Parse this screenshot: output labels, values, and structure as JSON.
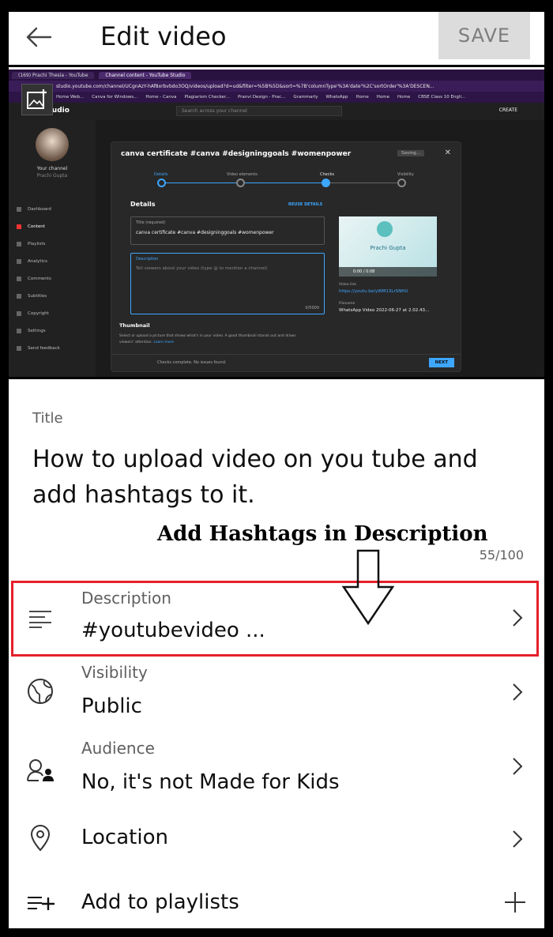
{
  "header": {
    "back_icon": "arrow-left-icon",
    "title": "Edit video",
    "save_label": "SAVE"
  },
  "screenshot": {
    "browser": {
      "tabs": [
        "(169) Prachi Thesia - YouTube",
        "Channel content - YouTube Studio"
      ],
      "address": "studio.youtube.com/channel/UCgnAzY-hAf8xrbvbdo3OQ/videos/upload?d=ud&filter=%5B%5D&sort=%7B'columnType'%3A'date'%2C'sortOrder'%3A'DESCEN...",
      "bookmarks": [
        "Home Web...",
        "Canva for Windows...",
        "Home - Canva",
        "Plagiarism Checker...",
        "Pranvi Design - Prac...",
        "Grammarly",
        "WhatsApp",
        "Home",
        "Home",
        "Home",
        "CBSE Class 10 Engli..."
      ]
    },
    "studio": {
      "logo": "Studio",
      "search_placeholder": "Search across your channel",
      "create": "CREATE",
      "channel_label": "Your channel",
      "channel_name": "Prachi Gupta",
      "nav": [
        "Dashboard",
        "Content",
        "Playlists",
        "Analytics",
        "Comments",
        "Subtitles",
        "Copyright",
        "Settings",
        "Send feedback"
      ]
    },
    "dialog": {
      "title": "canva certificate #canva #designinggoals #womenpower",
      "saving": "Saving...",
      "steps": [
        "Details",
        "Video elements",
        "Checks",
        "Visibility"
      ],
      "section": "Details",
      "reuse": "REUSE DETAILS",
      "title_field_label": "Title (required)",
      "title_field_value": "canva certificate #canva #designinggoals #womenpower",
      "desc_label": "Description",
      "desc_placeholder": "Tell viewers about your video (type @ to mention a channel)",
      "desc_count": "0/5000",
      "video_name": "Prachi Gupta",
      "time": "0:00 / 0:08",
      "video_link_label": "Video link",
      "video_link": "https://youtu.be/yWM13LrSNHU",
      "filename_label": "Filename",
      "filename": "WhatsApp Video 2022-06-27 at 2.02.43...",
      "thumbnail_heading": "Thumbnail",
      "thumbnail_text": "Select or upload a picture that shows what's in your video. A good thumbnail stands out and draws viewers' attention.",
      "learn_more": "Learn more",
      "checks_text": "Checks complete. No issues found.",
      "next": "NEXT"
    }
  },
  "settings": {
    "title_label": "Title",
    "title_value": "How to upload video on you tube and add hashtags to it.",
    "annotation": "Add Hashtags in Description",
    "char_counter": "55/100",
    "rows": [
      {
        "icon": "description-lines-icon",
        "label": "Description",
        "value": "#youtubevideo  ..."
      },
      {
        "icon": "globe-icon",
        "label": "Visibility",
        "value": "Public"
      },
      {
        "icon": "audience-icon",
        "label": "Audience",
        "value": "No, it's not Made for Kids"
      },
      {
        "icon": "location-pin-icon",
        "label": "",
        "value": "Location"
      },
      {
        "icon": "add-playlist-icon",
        "label": "",
        "value": "Add to playlists"
      }
    ]
  },
  "colors": {
    "highlight": "#e5202a",
    "save_bg": "#dcdcdc",
    "studio_accent": "#3ea6ff"
  }
}
